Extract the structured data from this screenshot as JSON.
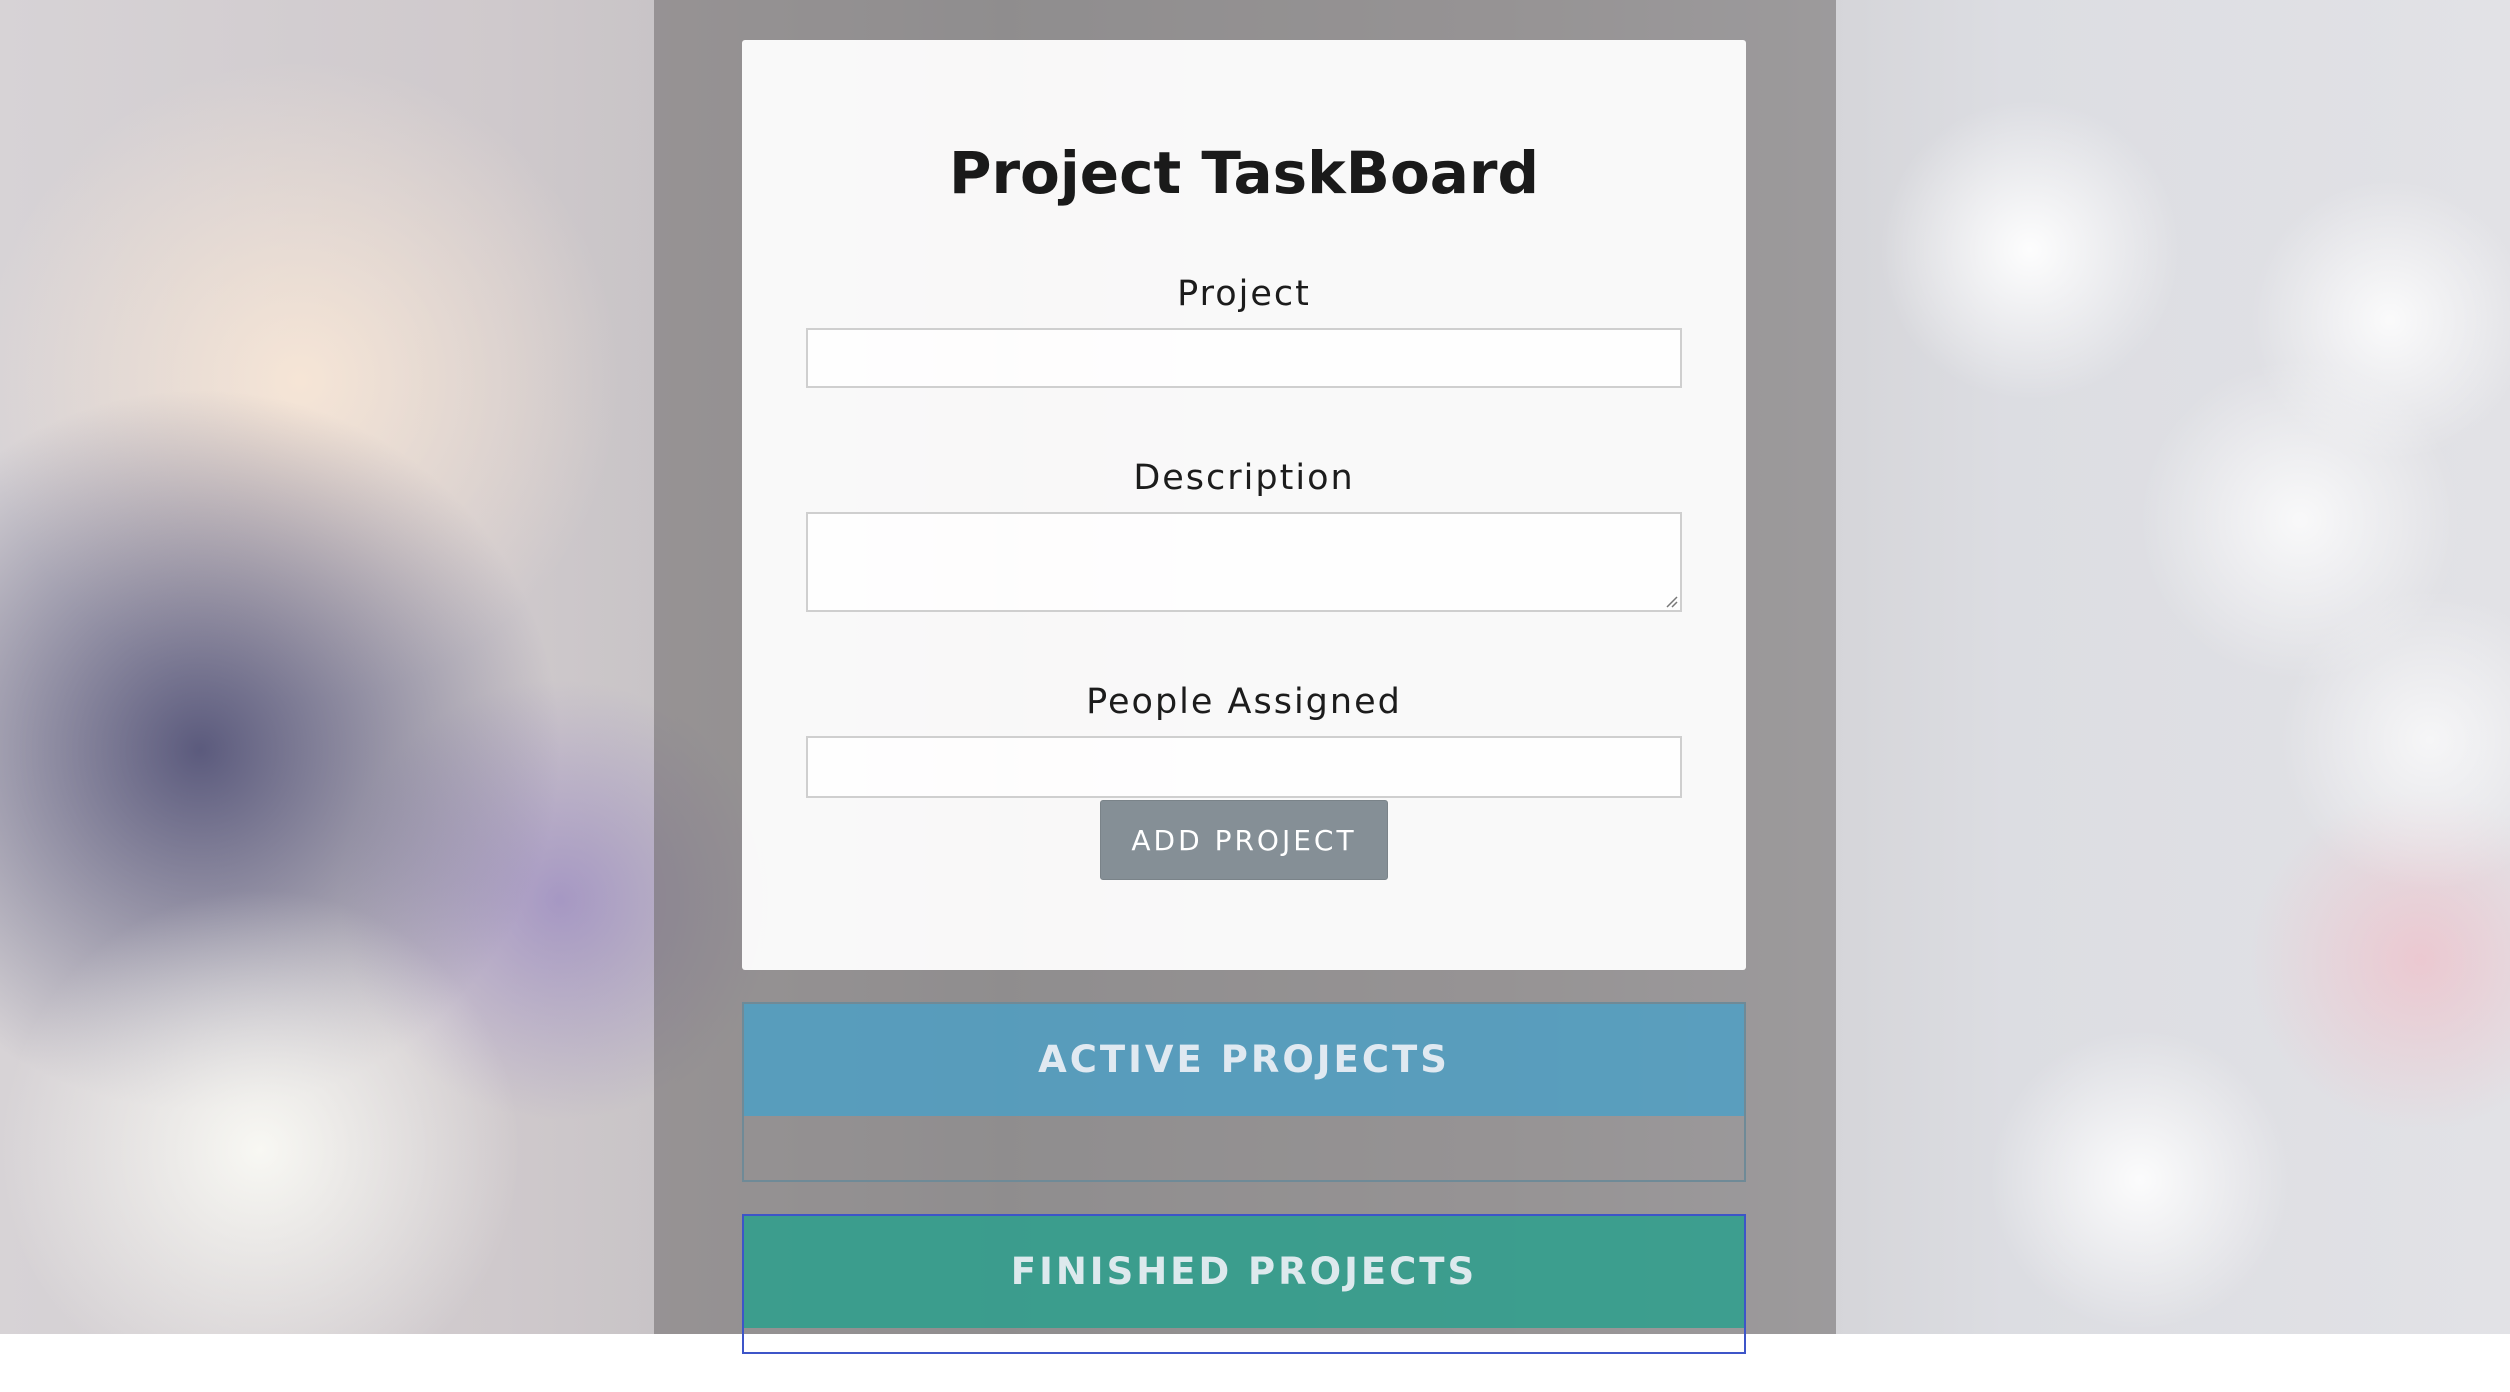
{
  "app": {
    "title": "Project TaskBoard"
  },
  "form": {
    "project_label": "Project",
    "project_value": "",
    "description_label": "Description",
    "description_value": "",
    "people_label": "People Assigned",
    "people_value": "",
    "submit_label": "ADD PROJECT"
  },
  "sections": {
    "active_title": "ACTIVE PROJECTS",
    "finished_title": "FINISHED PROJECTS"
  },
  "colors": {
    "active_header": "#48a0c8",
    "finished_header": "#28a08c",
    "button": "#858f96"
  }
}
